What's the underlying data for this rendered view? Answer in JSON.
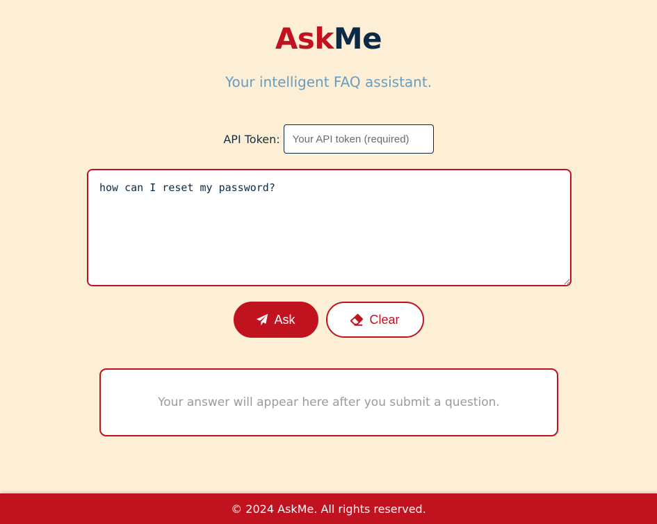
{
  "brand": {
    "part1": "Ask",
    "part2": "Me",
    "color1": "#c1121f",
    "color2": "#0b2a45"
  },
  "subtitle": "Your intelligent FAQ assistant.",
  "token": {
    "label": "API Token:",
    "placeholder": "Your API token (required)",
    "value": ""
  },
  "question": {
    "value": "how can I reset my password?"
  },
  "buttons": {
    "ask_label": "Ask",
    "ask_icon": "paper-plane-icon",
    "clear_label": "Clear",
    "clear_icon": "eraser-icon"
  },
  "answer": {
    "placeholder_text": "Your answer will appear here after you submit a question."
  },
  "footer": {
    "text": "© 2024 AskMe. All rights reserved."
  },
  "colors": {
    "background": "#fdefd6",
    "accent": "#c1121f",
    "navy": "#0b2a45",
    "subtitle": "#6a9cc0"
  }
}
